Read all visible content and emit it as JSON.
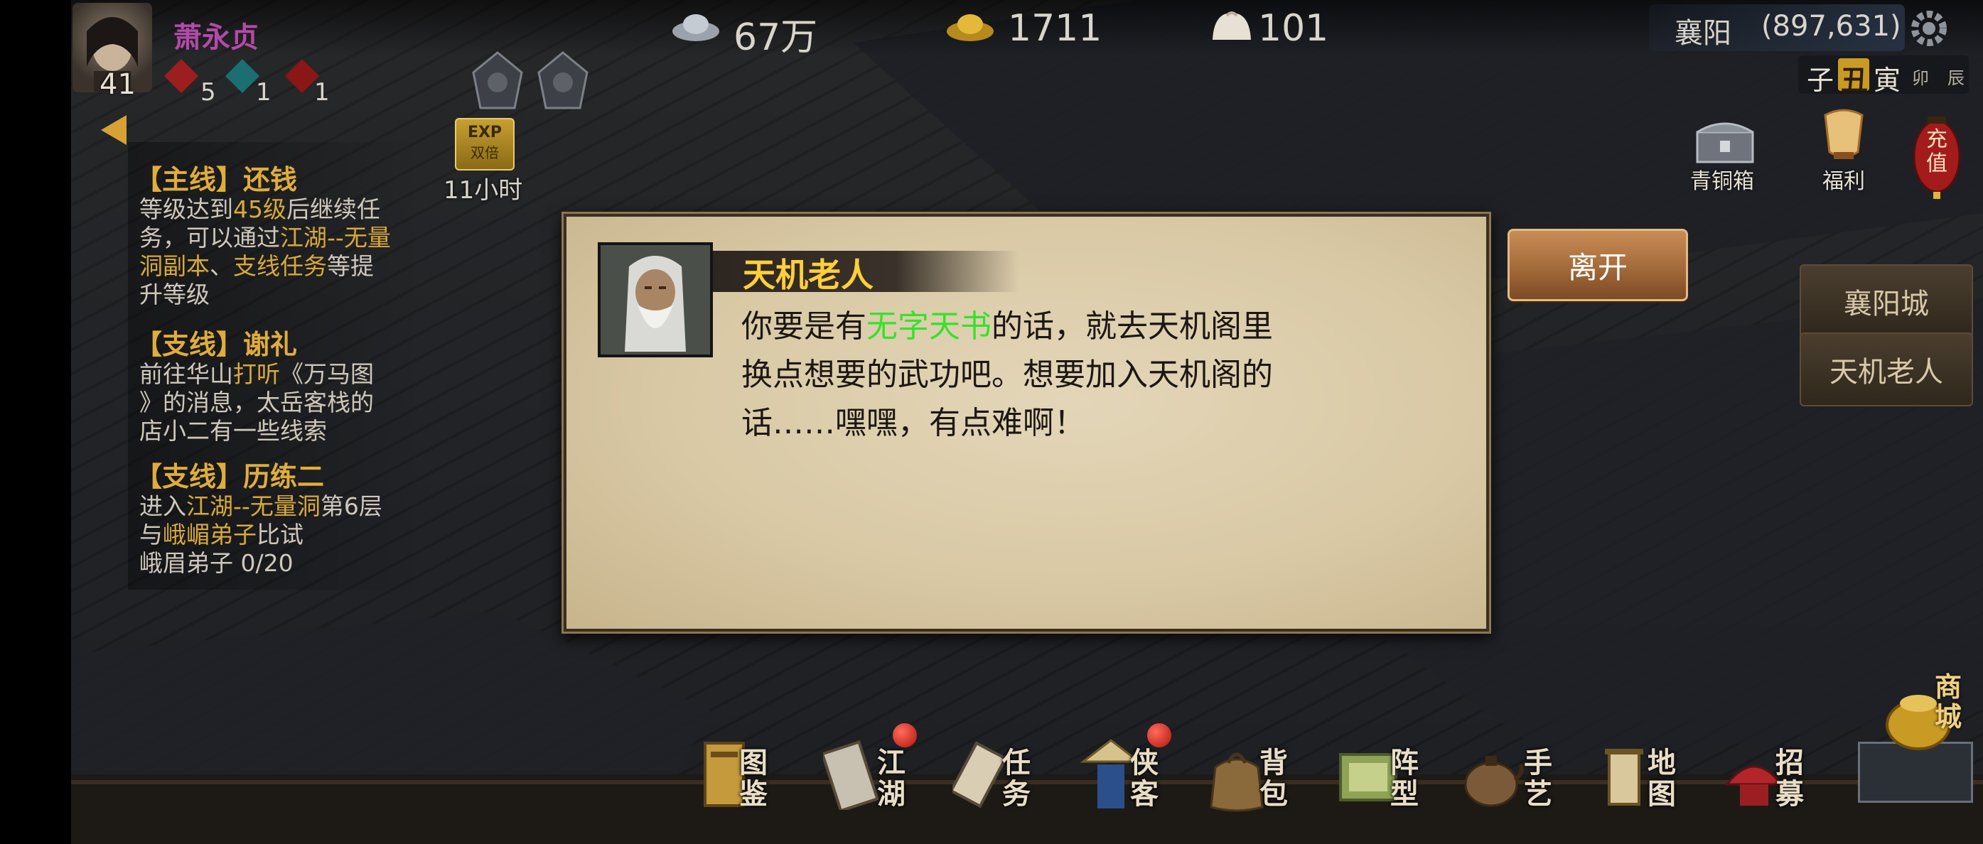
{
  "player": {
    "name": "萧永贞",
    "level": "41",
    "stat1": "5",
    "stat2": "1",
    "stat3": "1"
  },
  "resources": {
    "silver": "67万",
    "gold": "1711",
    "bun": "101"
  },
  "location": {
    "city": "襄阳",
    "coords": "(897,631)"
  },
  "time_bar": [
    "子",
    "丑",
    "寅",
    "卯",
    "辰"
  ],
  "exp_badge": {
    "label": "EXP",
    "sub": "双倍",
    "timer": "11小时"
  },
  "right_icons": {
    "chest": "青铜箱",
    "welfare": "福利",
    "recharge": "充值"
  },
  "quests": {
    "main": {
      "title": "【主线】还钱",
      "desc_a": "等级达到",
      "level": "45级",
      "desc_b": "后继续任",
      "desc_c": "务，可以通过",
      "link1": "江湖--无量",
      "link1b": "洞副本",
      "sep": "、",
      "link2": "支线任务",
      "desc_d": "等提",
      "desc_e": "升等级"
    },
    "side1": {
      "title": "【支线】谢礼",
      "l1a": "前往华山",
      "l1b": "打听",
      "l1c": "《万马图",
      "l2": "》的消息，太岳客栈的",
      "l3": "店小二有一些线索"
    },
    "side2": {
      "title": "【支线】历练二",
      "l1a": "进入",
      "l1b": "江湖--无量洞",
      "l1c": "第6层",
      "l2a": "与",
      "l2b": "峨嵋弟子",
      "l2c": "比试",
      "l3": "峨眉弟子  0/20"
    }
  },
  "dialog": {
    "speaker": "天机老人",
    "line1_a": "你要是有",
    "line1_b": "无字天书",
    "line1_c": "的话，就去天机阁里",
    "line2": "换点想要的武功吧。想要加入天机阁的",
    "line3": "话……嘿嘿，有点难啊！",
    "leave_button": "离开"
  },
  "side_buttons": [
    "襄阳城",
    "天机老人"
  ],
  "bottom_menu": [
    {
      "label": "图\n鉴"
    },
    {
      "label": "江\n湖"
    },
    {
      "label": "任\n务"
    },
    {
      "label": "侠\n客"
    },
    {
      "label": "背\n包"
    },
    {
      "label": "阵\n型"
    },
    {
      "label": "手\n艺"
    },
    {
      "label": "地\n图"
    },
    {
      "label": "招\n募"
    }
  ],
  "shop": "商城",
  "colors": {
    "gold": "#d8a93b",
    "green": "#35e22b",
    "speaker": "#ffcf3a",
    "name": "#b34aa8"
  }
}
